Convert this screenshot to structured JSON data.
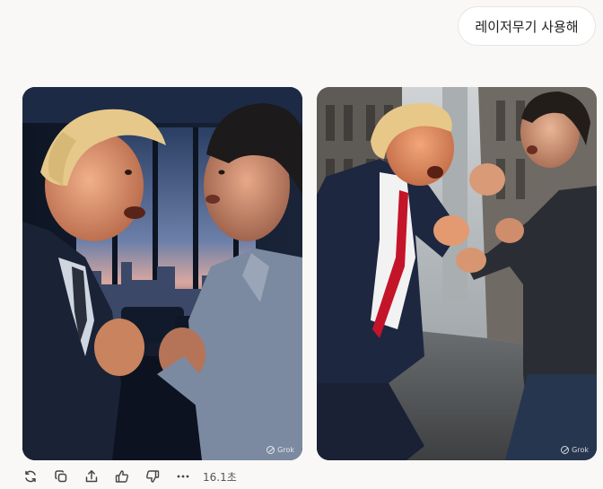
{
  "user_message": "레이저무기 사용해",
  "images": [
    {
      "watermark": "Grok"
    },
    {
      "watermark": "Grok"
    }
  ],
  "toolbar": {
    "icons": [
      "regenerate-icon",
      "copy-icon",
      "share-icon",
      "thumbs-up-icon",
      "thumbs-down-icon",
      "more-icon"
    ],
    "elapsed": "16.1초"
  },
  "colors": {
    "background": "#f9f8f6",
    "bubble": "#ffffff",
    "icon": "#444444"
  }
}
